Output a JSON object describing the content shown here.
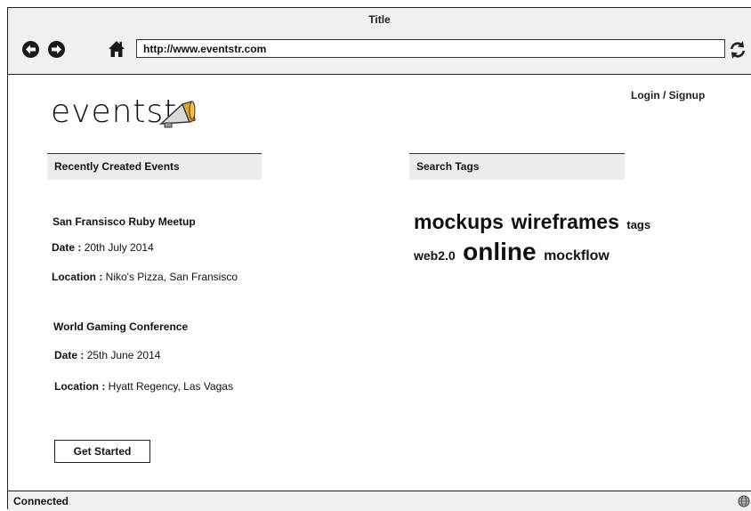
{
  "window": {
    "title": "Title"
  },
  "toolbar": {
    "url": "http://www.eventstr.com"
  },
  "header": {
    "logo_text": "eventst",
    "login_link": "Login / Signup"
  },
  "recent": {
    "heading": "Recently Created Events",
    "events": [
      {
        "title": "San Fransisco Ruby Meetup",
        "date_label": "Date :",
        "date": "20th July 2014",
        "location_label": "Location :",
        "location": "Niko's Pizza, San Fransisco"
      },
      {
        "title": "World Gaming Conference",
        "date_label": "Date :",
        "date": "25th June 2014",
        "location_label": "Location :",
        "location": "Hyatt Regency, Las Vagas"
      }
    ],
    "cta_label": "Get Started"
  },
  "search_tags": {
    "heading": "Search Tags",
    "tags": [
      "mockups",
      "wireframes",
      "tags",
      "web2.0",
      "online",
      "mockflow"
    ]
  },
  "status_bar": {
    "text": "Connected"
  },
  "icons": {
    "back": "back-arrow-icon",
    "forward": "forward-arrow-icon",
    "home": "home-icon",
    "refresh": "refresh-icon",
    "logo": "megaphone-icon",
    "status": "globe-icon"
  }
}
